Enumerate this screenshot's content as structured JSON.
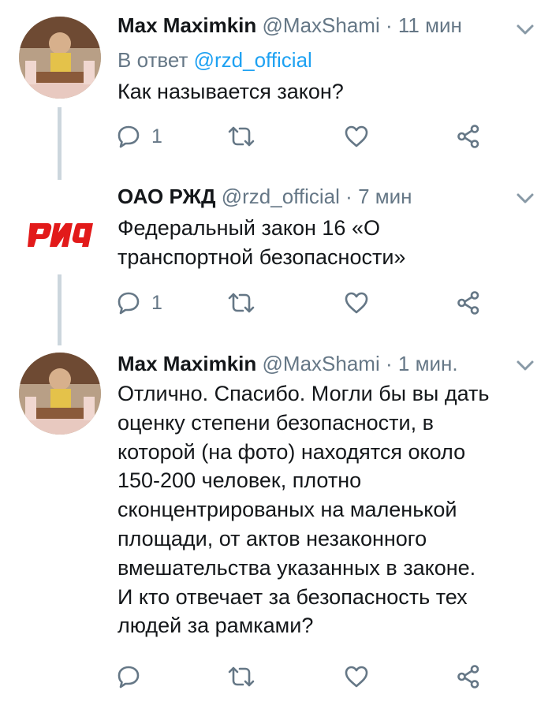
{
  "tweets": [
    {
      "author_name": "Max Maximkin",
      "handle": "@MaxShami",
      "separator": "·",
      "time": "11 мин",
      "reply_prefix": "В ответ",
      "reply_handle": "@rzd_official",
      "text": "Как называется закон?",
      "reply_count": "1"
    },
    {
      "author_name": "ОАО РЖД",
      "handle": "@rzd_official",
      "separator": "·",
      "time": "7 мин",
      "text_lines": [
        "Федеральный закон 16 «О",
        "транспортной безопасности»"
      ],
      "reply_count": "1"
    },
    {
      "author_name": "Max Maximkin",
      "handle": "@MaxShami",
      "separator": "·",
      "time": "1 мин.",
      "text_lines": [
        "Отлично. Спасибо. Могли бы вы дать",
        "оценку степени безопасности, в",
        "которой (на фото) находятся около",
        "150-200 человек, плотно",
        "сконцентрированых на маленькой",
        "площади, от актов незаконного",
        "вмешательства указанных в законе.",
        "И кто отвечает за безопасность тех",
        "людей за рамками?"
      ]
    }
  ],
  "colors": {
    "link": "#1da1f2",
    "secondary_text": "#657786",
    "thread_line": "#ccd6dd",
    "rzd_red": "#e21a1a"
  },
  "icons": [
    "reply-icon",
    "retweet-icon",
    "like-icon",
    "share-icon",
    "chevron-down-icon",
    "rzd-logo"
  ]
}
